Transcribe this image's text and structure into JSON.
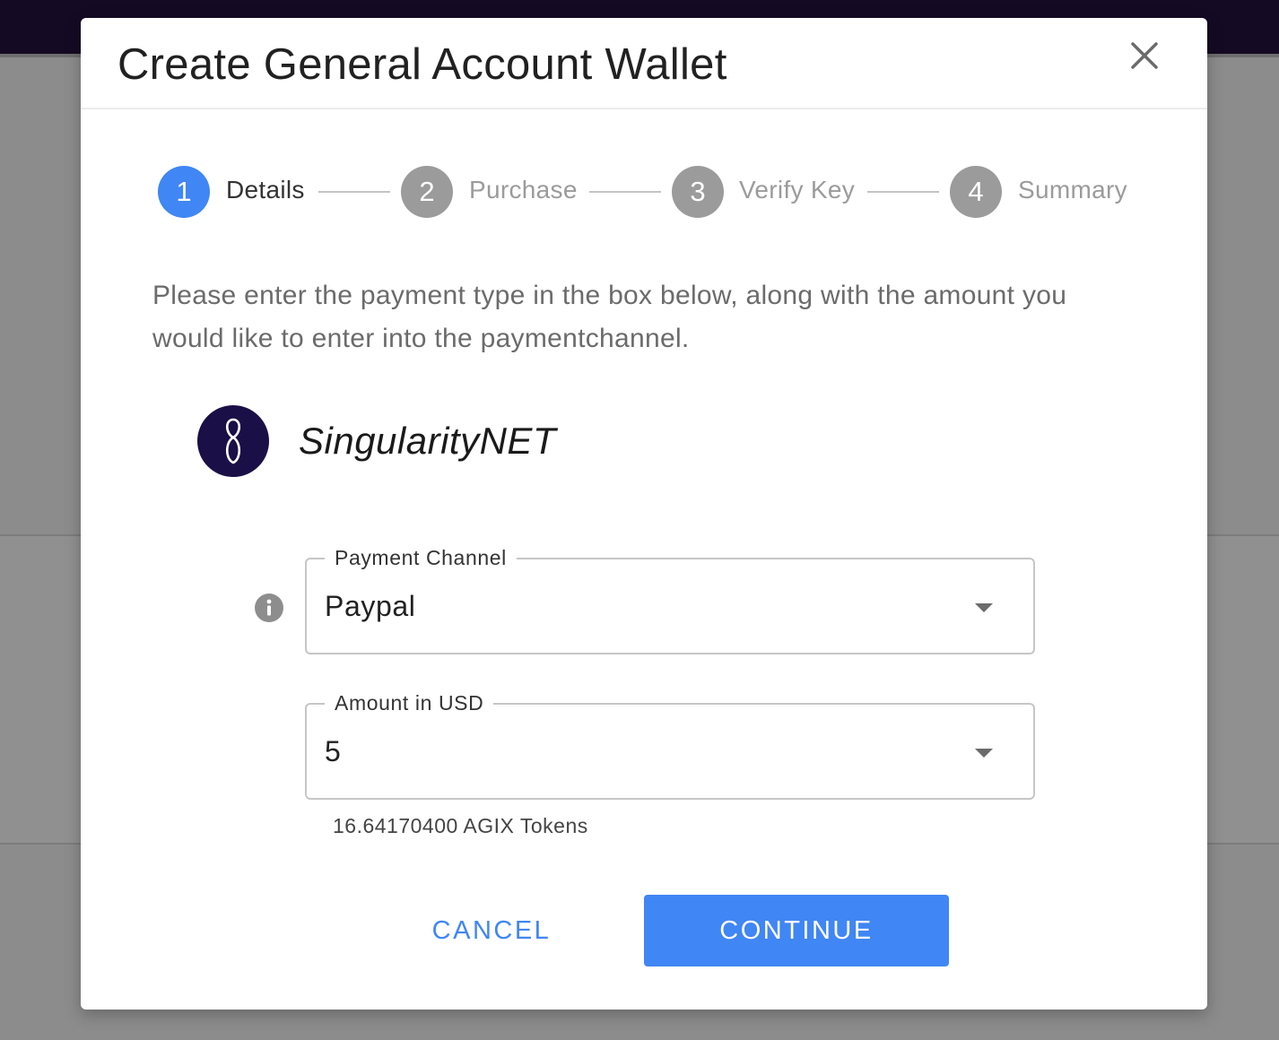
{
  "modal": {
    "title": "Create General Account Wallet",
    "close_icon": "close-icon"
  },
  "stepper": {
    "steps": [
      {
        "number": "1",
        "label": "Details",
        "state": "active"
      },
      {
        "number": "2",
        "label": "Purchase",
        "state": "inactive"
      },
      {
        "number": "3",
        "label": "Verify Key",
        "state": "inactive"
      },
      {
        "number": "4",
        "label": "Summary",
        "state": "inactive"
      }
    ]
  },
  "description": "Please enter the payment type in the box below, along with the amount you would like to enter into the paymentchannel.",
  "brand": {
    "name": "SingularityNET",
    "logo_icon": "singularitynet-logo-icon"
  },
  "info_icon": "info-icon",
  "payment_channel": {
    "label": "Payment Channel",
    "value": "Paypal"
  },
  "amount": {
    "label": "Amount in USD",
    "value": "5",
    "helper": "16.64170400 AGIX Tokens"
  },
  "actions": {
    "cancel_label": "CANCEL",
    "continue_label": "CONTINUE"
  },
  "colors": {
    "accent": "#4086f4",
    "inactive_step": "#9b9b9b",
    "brand_logo_bg": "#1b0f47",
    "topbar": "#150a24",
    "backdrop": "#8c8c8c"
  }
}
